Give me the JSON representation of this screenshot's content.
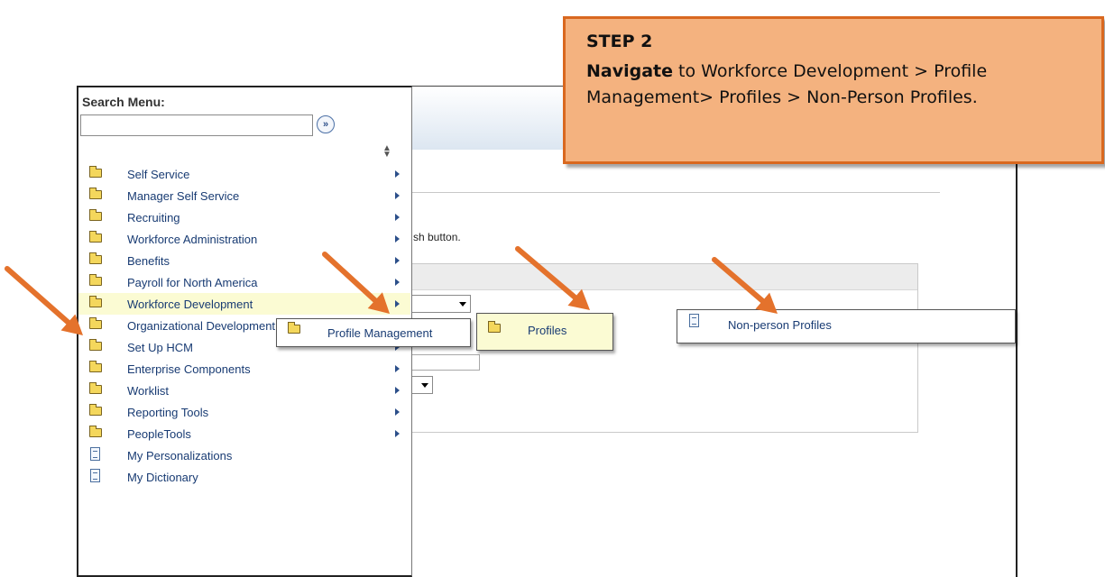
{
  "search": {
    "label": "Search Menu:",
    "input_value": "",
    "go_icon": "double-chevron-right-icon"
  },
  "menu": {
    "items": [
      {
        "label": "Self Service",
        "icon": "folder-icon",
        "has_submenu": true
      },
      {
        "label": "Manager Self Service",
        "icon": "folder-icon",
        "has_submenu": true
      },
      {
        "label": "Recruiting",
        "icon": "folder-icon",
        "has_submenu": true
      },
      {
        "label": "Workforce Administration",
        "icon": "folder-icon",
        "has_submenu": true
      },
      {
        "label": "Benefits",
        "icon": "folder-icon",
        "has_submenu": true
      },
      {
        "label": "Payroll for North America",
        "icon": "folder-icon",
        "has_submenu": true
      },
      {
        "label": "Workforce Development",
        "icon": "folder-icon",
        "has_submenu": true,
        "highlighted": true
      },
      {
        "label": "Organizational Development",
        "icon": "folder-icon",
        "has_submenu": true
      },
      {
        "label": "Set Up HCM",
        "icon": "folder-icon",
        "has_submenu": true
      },
      {
        "label": "Enterprise Components",
        "icon": "folder-icon",
        "has_submenu": true
      },
      {
        "label": "Worklist",
        "icon": "folder-icon",
        "has_submenu": true
      },
      {
        "label": "Reporting Tools",
        "icon": "folder-icon",
        "has_submenu": true
      },
      {
        "label": "PeopleTools",
        "icon": "folder-icon",
        "has_submenu": true
      },
      {
        "label": "My Personalizations",
        "icon": "document-icon",
        "has_submenu": false
      },
      {
        "label": "My Dictionary",
        "icon": "document-icon",
        "has_submenu": false
      }
    ]
  },
  "flyouts": {
    "profile_management": "Profile Management",
    "profiles": "Profiles",
    "non_person_profiles": "Non-person Profiles"
  },
  "page": {
    "instruction_fragment": "sh button."
  },
  "callout": {
    "step": "STEP 2",
    "action": "Navigate",
    "text": " to Workforce Development > Profile Management> Profiles > Non-Person Profiles."
  },
  "colors": {
    "menu_text": "#183b73",
    "highlight": "#fbfbd3",
    "callout_fill": "#f4b27f",
    "callout_border": "#d9681f",
    "arrow": "#e4722c"
  }
}
